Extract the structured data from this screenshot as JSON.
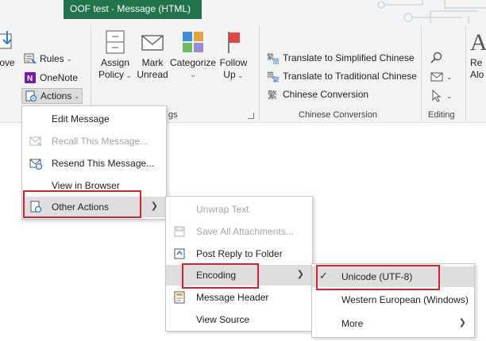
{
  "window": {
    "title": "OOF test  -  Message (HTML)"
  },
  "ribbon": {
    "move_label": "ove",
    "rules_label": "Rules",
    "onenote_label": "OneNote",
    "actions_label": "Actions",
    "assign_policy": {
      "line1": "Assign",
      "line2": "Policy"
    },
    "mark_unread": {
      "line1": "Mark",
      "line2": "Unread"
    },
    "categorize": {
      "line1": "Categorize"
    },
    "follow_up": {
      "line1": "Follow",
      "line2": "Up"
    },
    "tags_group_partial": "gs",
    "translate_simplified": "Translate to Simplified Chinese",
    "translate_traditional": "Translate to Traditional Chinese",
    "chinese_conversion_btn": "Chinese Conversion",
    "chinese_conversion_group": "Chinese Conversion",
    "editing_group": "Editing",
    "right_partial": {
      "line1": "Re",
      "line2": "Alo"
    }
  },
  "actions_menu": {
    "items": [
      {
        "label": "Edit Message",
        "enabled": true
      },
      {
        "label": "Recall This Message...",
        "enabled": false
      },
      {
        "label": "Resend This Message...",
        "enabled": true
      },
      {
        "label": "View in Browser",
        "enabled": true
      },
      {
        "label": "Other Actions",
        "enabled": true
      }
    ]
  },
  "other_actions_menu": {
    "items": [
      {
        "label": "Unwrap Text",
        "enabled": false
      },
      {
        "label": "Save All Attachments...",
        "enabled": false
      },
      {
        "label": "Post Reply to Folder",
        "enabled": true
      },
      {
        "label": "Encoding",
        "enabled": true
      },
      {
        "label": "Message Header",
        "enabled": true
      },
      {
        "label": "View Source",
        "enabled": true
      }
    ]
  },
  "encoding_menu": {
    "items": [
      {
        "label": "Unicode (UTF-8)",
        "checked": true
      },
      {
        "label": "Western European (Windows)",
        "checked": false
      },
      {
        "label": "More",
        "checked": false
      }
    ]
  },
  "colors": {
    "title_bg": "#21734a",
    "ribbon_bg": "#f3f3f3",
    "highlight_border": "#d6222a",
    "menu_hover": "#dedede"
  }
}
